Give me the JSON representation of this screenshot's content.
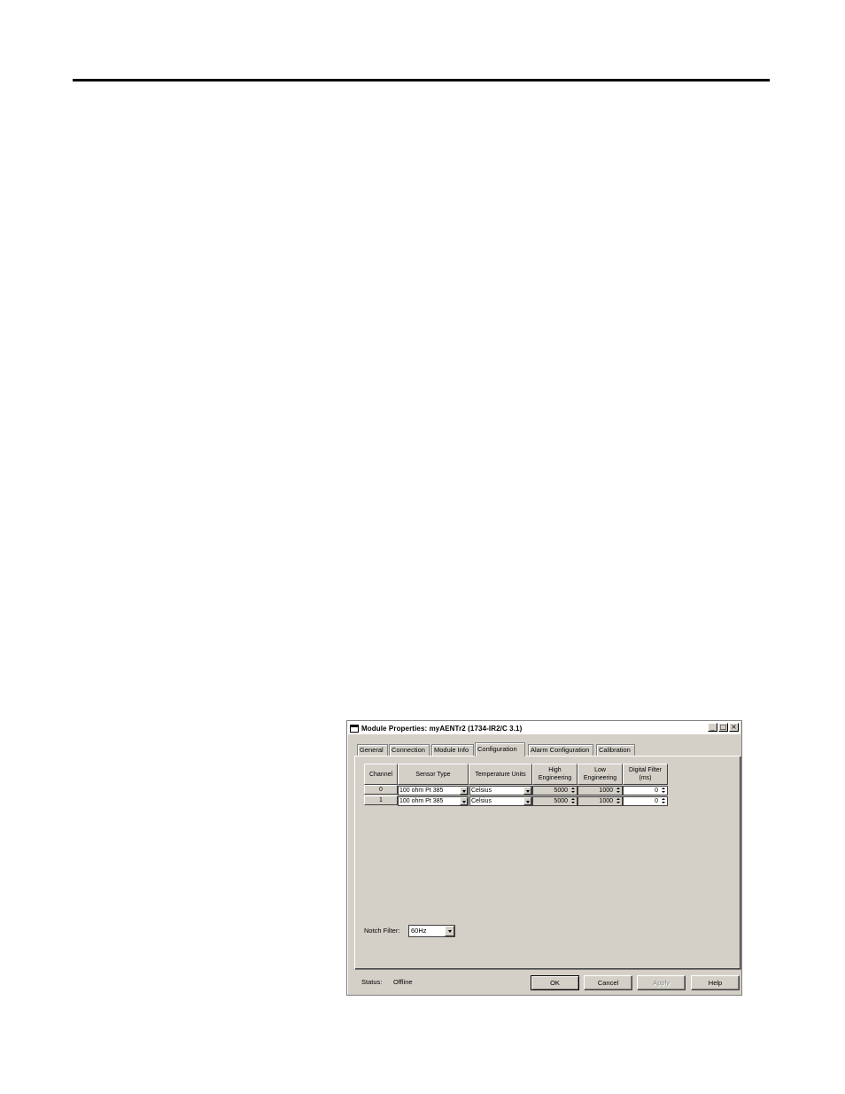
{
  "dialog": {
    "title": "Module Properties: myAENTr2 (1734-IR2/C 3.1)",
    "controls": [
      "_",
      "□",
      "×"
    ]
  },
  "tabs": [
    {
      "label": "General"
    },
    {
      "label": "Connection"
    },
    {
      "label": "Module Info"
    },
    {
      "label": "Configuration",
      "active": true
    },
    {
      "label": "Alarm Configuration"
    },
    {
      "label": "Calibration"
    }
  ],
  "grid": {
    "headers": {
      "channel": "Channel",
      "sensor_type": "Sensor Type",
      "temperature_units": "Temperature Units",
      "high_engineering": "High Engineering",
      "low_engineering": "Low Engineering",
      "digital_filter": "Digital Filter (ms)"
    },
    "rows": [
      {
        "channel": "0",
        "sensor_type": "100 ohm Pt 385",
        "temperature_units": "Celsius",
        "high_engineering": "5000",
        "low_engineering": "1000",
        "digital_filter": "0"
      },
      {
        "channel": "1",
        "sensor_type": "100 ohm Pt 385",
        "temperature_units": "Celsius",
        "high_engineering": "5000",
        "low_engineering": "1000",
        "digital_filter": "0"
      }
    ]
  },
  "notch_filter": {
    "label": "Notch Filter:",
    "value": "60Hz"
  },
  "status": {
    "label": "Status:",
    "value": "Offline"
  },
  "buttons": {
    "ok": "OK",
    "cancel": "Cancel",
    "apply": "Apply",
    "help": "Help"
  }
}
